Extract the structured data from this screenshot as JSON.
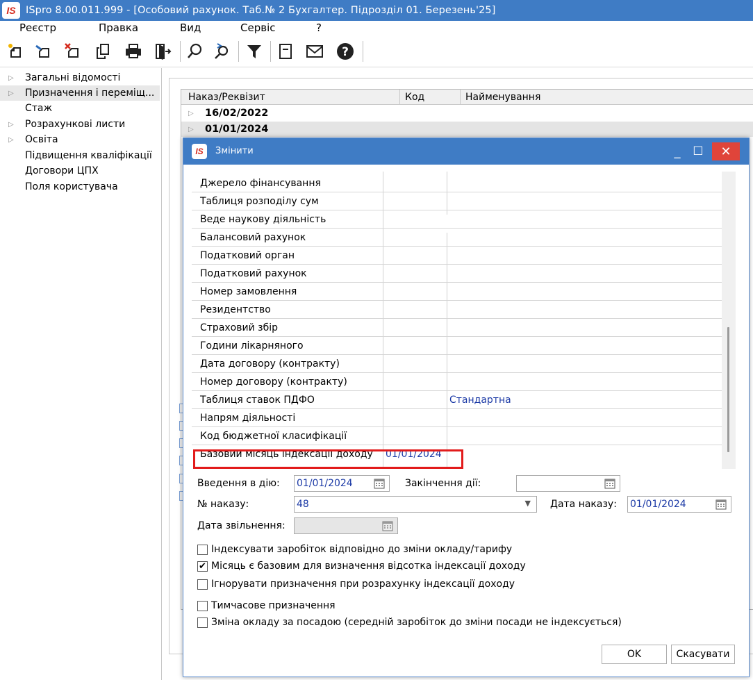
{
  "window": {
    "title": "ISpro 8.00.011.999 - [Особовий рахунок. Таб.№ 2 Бухгалтер. Підрозділ 01. Березень'25]",
    "logo_text": "IS"
  },
  "menu": [
    "Реєстр",
    "Правка",
    "Вид",
    "Сервіс",
    "?"
  ],
  "toolbar_icons": [
    "new-icon",
    "edit-icon",
    "delete-icon",
    "copy-icon",
    "print-icon",
    "exit-icon",
    "search-icon",
    "find-next-icon",
    "filter-icon",
    "form-icon",
    "mail-icon",
    "help-icon"
  ],
  "sidebar": {
    "items": [
      {
        "label": "Загальні відомості",
        "arrow": "▷"
      },
      {
        "label": "Призначення і переміщ...",
        "arrow": "▷"
      },
      {
        "label": "Стаж",
        "arrow": ""
      },
      {
        "label": "Розрахункові листи",
        "arrow": "▷"
      },
      {
        "label": "Освіта",
        "arrow": "▷"
      },
      {
        "label": "Підвищення кваліфікації",
        "arrow": ""
      },
      {
        "label": "Договори ЦПХ",
        "arrow": ""
      },
      {
        "label": "Поля користувача",
        "arrow": ""
      }
    ]
  },
  "main_table": {
    "columns": [
      "Наказ/Реквізит",
      "Код",
      "Найменування"
    ],
    "rows": [
      {
        "label": "16/02/2022",
        "arrow": "▷"
      },
      {
        "label": "01/01/2024",
        "arrow": "▷"
      }
    ]
  },
  "dialog": {
    "title": "Змінити",
    "logo_text": "IS",
    "controls": {
      "minimize": "_",
      "maximize": "☐",
      "close": "✕"
    },
    "grid_rows": [
      {
        "name": "Джерело фінансування",
        "value": ""
      },
      {
        "name": "Таблиця розподілу сум",
        "value": ""
      },
      {
        "name": "Веде наукову діяльність",
        "value": ""
      },
      {
        "name": "Балансовий рахунок",
        "value": ""
      },
      {
        "name": "Податковий орган",
        "value": ""
      },
      {
        "name": "Податковий рахунок",
        "value": ""
      },
      {
        "name": "Номер замовлення",
        "value": ""
      },
      {
        "name": "Резидентство",
        "value": ""
      },
      {
        "name": "Страховий збір",
        "value": ""
      },
      {
        "name": "Години лікарняного",
        "value": ""
      },
      {
        "name": "Дата договору (контракту)",
        "value": ""
      },
      {
        "name": "Номер договору (контракту)",
        "value": ""
      },
      {
        "name": "Таблиця ставок ПДФО",
        "value": "Стандартна"
      },
      {
        "name": "Напрям діяльності",
        "value": ""
      },
      {
        "name": "Код бюджетної класифікації",
        "value": ""
      },
      {
        "name": "Базовий місяць індексації доходу",
        "value": "01/01/2024"
      }
    ],
    "form": {
      "start_label": "Введення в дію:",
      "start_value": "01/01/2024",
      "end_label": "Закінчення дії:",
      "end_value": "",
      "order_no_label": "№ наказу:",
      "order_no_value": "48",
      "order_date_label": "Дата наказу:",
      "order_date_value": "01/01/2024",
      "dismissal_label": "Дата звільнення:",
      "dismissal_value": ""
    },
    "checkboxes": [
      {
        "label": "Індексувати заробіток відповідно до зміни окладу/тарифу",
        "checked": false,
        "mark": ""
      },
      {
        "label": "Місяць є базовим для визначення відсотка індексації доходу",
        "checked": true,
        "mark": "✔"
      },
      {
        "label": "Ігнорувати призначення при розрахунку індексації доходу",
        "checked": false,
        "mark": ""
      },
      {
        "label": "Тимчасове призначення",
        "checked": false,
        "mark": ""
      },
      {
        "label": "Зміна окладу за посадою (середній заробіток до зміни посади не індексується)",
        "checked": false,
        "mark": ""
      }
    ],
    "buttons": {
      "ok": "OK",
      "cancel": "Скасувати"
    }
  },
  "colors": {
    "titlebar": "#3f7cc5",
    "value_text": "#1c3aa6",
    "highlight": "#e21b1b",
    "close": "#e0443a"
  }
}
